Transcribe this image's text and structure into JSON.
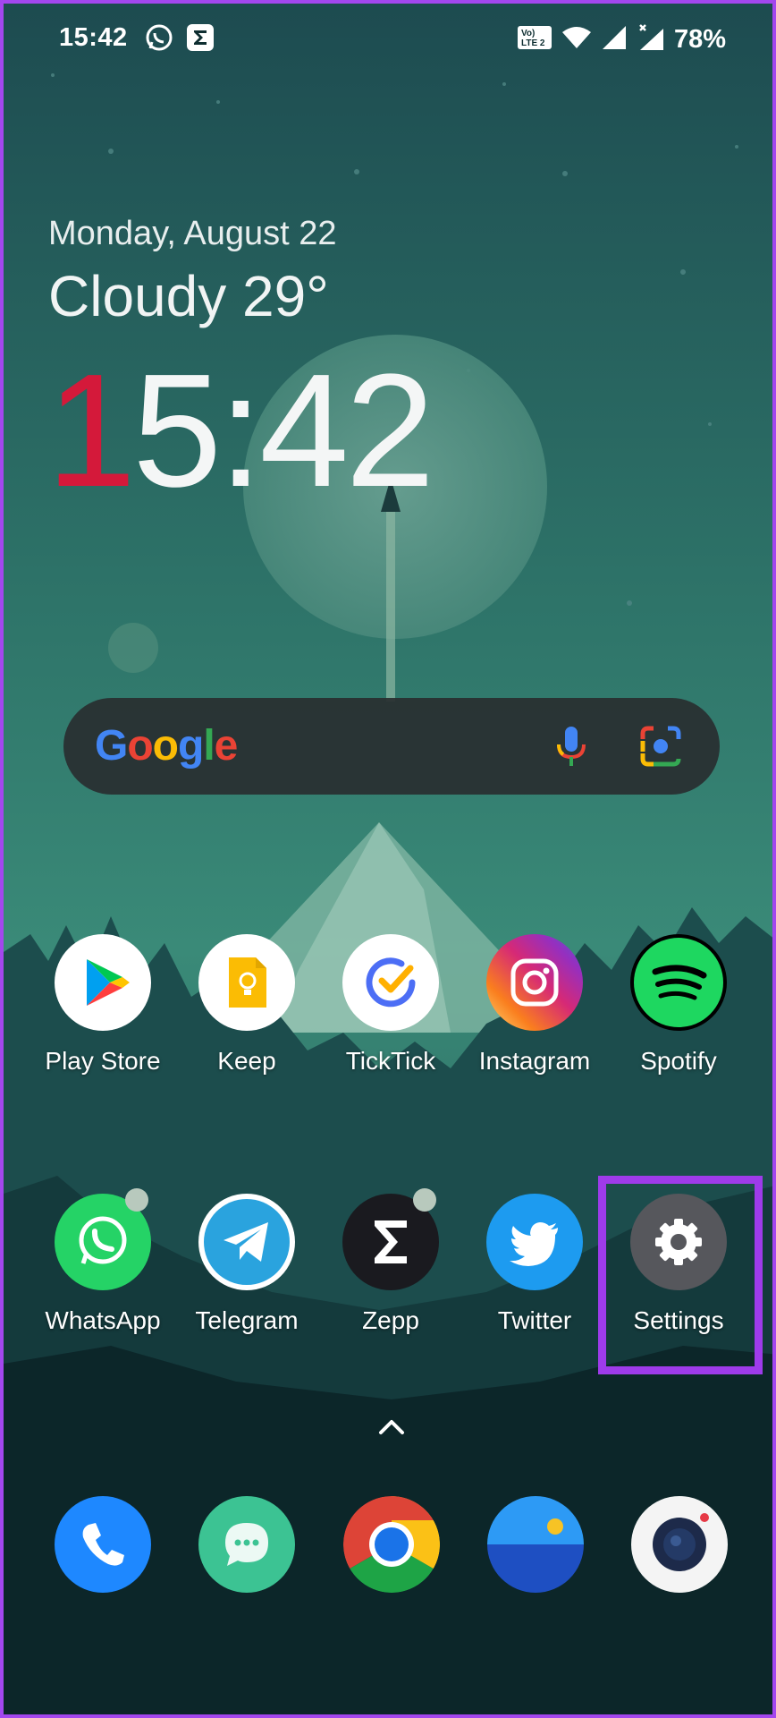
{
  "status_bar": {
    "time": "15:42",
    "left_icons": [
      "whatsapp-icon",
      "zepp-icon"
    ],
    "network_label": "Vo) 1 LTE 2",
    "right_icons": [
      "volte-icon",
      "wifi-icon",
      "signal-icon",
      "signal-no-service-icon"
    ],
    "battery": "78%"
  },
  "clock_widget": {
    "date": "Monday, August 22",
    "weather": "Cloudy 29°",
    "time_first_digit": "1",
    "time_rest": "5:42"
  },
  "search": {
    "logo": "Google",
    "icons": [
      "mic-icon",
      "google-lens-icon"
    ]
  },
  "apps_row1": [
    {
      "label": "Play Store",
      "icon": "play-store-icon"
    },
    {
      "label": "Keep",
      "icon": "keep-icon"
    },
    {
      "label": "TickTick",
      "icon": "ticktick-icon"
    },
    {
      "label": "Instagram",
      "icon": "instagram-icon"
    },
    {
      "label": "Spotify",
      "icon": "spotify-icon"
    }
  ],
  "apps_row2": [
    {
      "label": "WhatsApp",
      "icon": "whatsapp-icon"
    },
    {
      "label": "Telegram",
      "icon": "telegram-icon"
    },
    {
      "label": "Zepp",
      "icon": "zepp-icon"
    },
    {
      "label": "Twitter",
      "icon": "twitter-icon"
    },
    {
      "label": "Settings",
      "icon": "gear-icon"
    }
  ],
  "dock": [
    "phone-icon",
    "messages-icon",
    "chrome-icon",
    "gallery-icon",
    "camera-icon"
  ],
  "colors": {
    "highlight": "#9e3bea",
    "clock_accent": "#d4193a",
    "wallpaper_top": "#1f4e53",
    "wallpaper_bottom": "#0a2226"
  }
}
